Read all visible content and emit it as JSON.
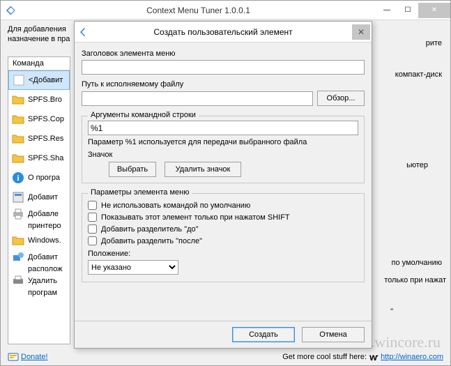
{
  "main": {
    "title": "Context Menu Tuner 1.0.0.1",
    "intro_line1": "Для добавления",
    "intro_line2": "назначение в пра",
    "list_header": "Команда",
    "items": [
      {
        "label": "<Добавит",
        "icon": "blank"
      },
      {
        "label": "SPFS.Bro",
        "icon": "folder"
      },
      {
        "label": "SPFS.Cop",
        "icon": "folder"
      },
      {
        "label": "SPFS.Res",
        "icon": "folder"
      },
      {
        "label": "SPFS.Sha",
        "icon": "folder"
      },
      {
        "label": "О програ",
        "icon": "info"
      },
      {
        "label": "Добавит",
        "icon": "app"
      },
      {
        "label": "Добавле",
        "icon": "printer"
      },
      {
        "label": "принтеро",
        "icon": ""
      },
      {
        "label": "Windows.",
        "icon": "folder"
      },
      {
        "label": "Добавит",
        "icon": "network"
      },
      {
        "label": "располож",
        "icon": ""
      },
      {
        "label": "Удалить",
        "icon": "printer2"
      },
      {
        "label": "програм",
        "icon": ""
      }
    ],
    "right_hints": {
      "r1": "рите",
      "r2": "компакт-диск",
      "r3": "ьютер",
      "r4": "по умолчанию",
      "r5": "только при нажат",
      "r6": "\""
    },
    "footer": {
      "donate": "Donate!",
      "more_stuff": "Get more cool stuff here:",
      "link": "http://winaero.com"
    },
    "watermark": "www.wincore.ru"
  },
  "dialog": {
    "title": "Создать пользовательский элемент",
    "lbl_caption": "Заголовок элемента меню",
    "val_caption": "",
    "lbl_path": "Путь к исполняемому файлу",
    "val_path": "",
    "btn_browse": "Обзор...",
    "grp_args_title": "Аргументы командной строки",
    "val_args": "%1",
    "hint_args": "Параметр %1 используется для передачи выбранного файла",
    "lbl_icon": "Значок",
    "btn_pick_icon": "Выбрать",
    "btn_del_icon": "Удалить значок",
    "grp_params_title": "Параметры элемента меню",
    "chk1": "Не использовать командой по умолчанию",
    "chk2": "Показывать этот элемент только при нажатом SHIFT",
    "chk3": "Добавить разделитель \"до\"",
    "chk4": "Добавить разделить \"после\"",
    "lbl_position": "Положение:",
    "position_value": "Не указано",
    "btn_create": "Создать",
    "btn_cancel": "Отмена"
  }
}
